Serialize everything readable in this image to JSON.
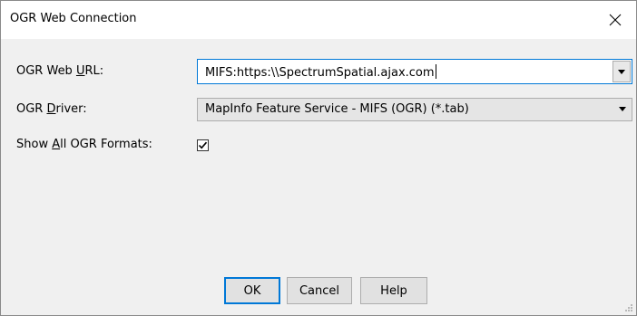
{
  "window": {
    "title": "OGR Web Connection",
    "close_glyph": "×"
  },
  "form": {
    "url_label_pre": "OGR Web ",
    "url_label_key": "U",
    "url_label_post": "RL:",
    "url_value": "MIFS:https:\\\\SpectrumSpatial.ajax.com",
    "driver_label_pre": "OGR ",
    "driver_label_key": "D",
    "driver_label_post": "river:",
    "driver_value": "MapInfo Feature Service  - MIFS (OGR) (*.tab)",
    "show_all_label_pre": "Show ",
    "show_all_label_key": "A",
    "show_all_label_post": "ll OGR Formats:",
    "show_all_checked": true
  },
  "buttons": {
    "ok_label": "OK",
    "cancel_label": "Cancel",
    "help_label": "Help"
  },
  "icons": {
    "close": "close-icon",
    "dropdown": "chevron-down-icon",
    "check": "checkmark-icon",
    "resize": "resize-grip-icon"
  },
  "colors": {
    "accent": "#0078d7",
    "dialog_bg": "#f0f0f0",
    "title_bg": "#ffffff"
  }
}
